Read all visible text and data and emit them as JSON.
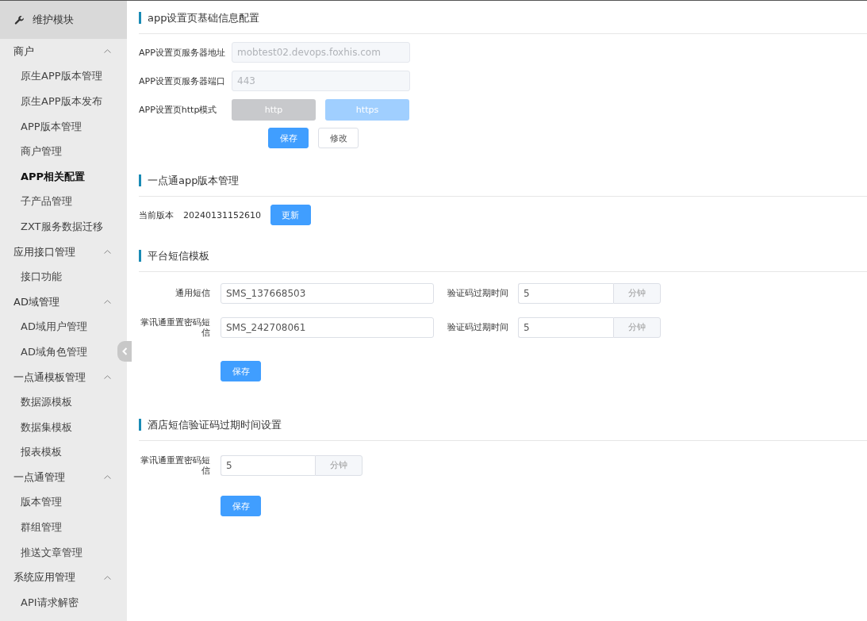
{
  "sidebar": {
    "header": "维护模块",
    "groups": [
      {
        "label": "商户",
        "expanded": true,
        "children": [
          {
            "label": "原生APP版本管理",
            "selected": false
          },
          {
            "label": "原生APP版本发布",
            "selected": false
          },
          {
            "label": "APP版本管理",
            "selected": false
          },
          {
            "label": "商户管理",
            "selected": false
          },
          {
            "label": "APP相关配置",
            "selected": true
          },
          {
            "label": "子产品管理",
            "selected": false
          },
          {
            "label": "ZXT服务数据迁移",
            "selected": false
          }
        ]
      },
      {
        "label": "应用接口管理",
        "expanded": true,
        "children": [
          {
            "label": "接口功能",
            "selected": false
          }
        ]
      },
      {
        "label": "AD域管理",
        "expanded": true,
        "children": [
          {
            "label": "AD域用户管理",
            "selected": false
          },
          {
            "label": "AD域角色管理",
            "selected": false
          }
        ]
      },
      {
        "label": "一点通模板管理",
        "expanded": true,
        "children": [
          {
            "label": "数据源模板",
            "selected": false
          },
          {
            "label": "数据集模板",
            "selected": false
          },
          {
            "label": "报表模板",
            "selected": false
          }
        ]
      },
      {
        "label": "一点通管理",
        "expanded": true,
        "children": [
          {
            "label": "版本管理",
            "selected": false
          },
          {
            "label": "群组管理",
            "selected": false
          },
          {
            "label": "推送文章管理",
            "selected": false
          }
        ]
      },
      {
        "label": "系统应用管理",
        "expanded": true,
        "children": [
          {
            "label": "API请求解密",
            "selected": false
          }
        ]
      }
    ]
  },
  "app_settings": {
    "title": "app设置页基础信息配置",
    "fields": [
      {
        "label": "APP设置页服务器地址",
        "value": "mobtest02.devops.foxhis.com",
        "disabled": true
      },
      {
        "label": "APP设置页服务器端口",
        "value": "443",
        "disabled": true
      }
    ],
    "mode": {
      "label": "APP设置页http模式",
      "options": [
        {
          "label": "http",
          "selected": false
        },
        {
          "label": "https",
          "selected": true
        }
      ]
    },
    "buttons": [
      {
        "label": "保存",
        "kind": "primary"
      },
      {
        "label": "修改",
        "kind": "default"
      }
    ]
  },
  "version": {
    "title": "一点通app版本管理",
    "label": "当前版本",
    "value": "20240131152610",
    "button": "更新"
  },
  "sms_templates": {
    "title": "平台短信模板",
    "rows": [
      {
        "label": "通用短信",
        "value": "SMS_137668503",
        "expiry_label": "验证码过期时间",
        "expiry": "5",
        "unit": "分钟"
      },
      {
        "label": "掌讯通重置密码短信",
        "value": "SMS_242708061",
        "expiry_label": "验证码过期时间",
        "expiry": "5",
        "unit": "分钟"
      }
    ],
    "button": "保存"
  },
  "hotel_sms": {
    "title": "酒店短信验证码过期时间设置",
    "label": "掌讯通重置密码短信",
    "value": "5",
    "unit": "分钟",
    "button": "保存"
  }
}
